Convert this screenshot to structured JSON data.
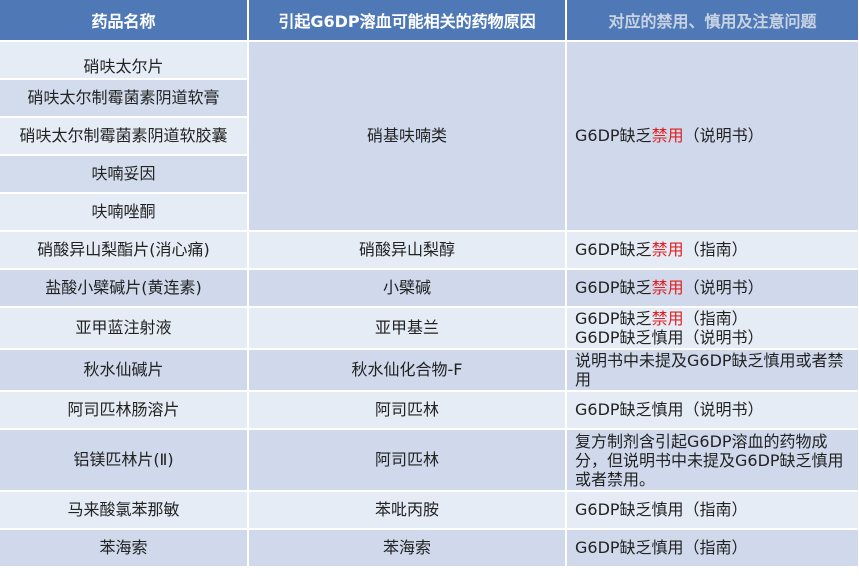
{
  "headers": [
    "药品名称",
    "引起G6DP溶血可能相关的药物原因",
    "对应的禁用、慎用及注意问题"
  ],
  "nitro_group": {
    "drugs": [
      "硝呋太尔片",
      "硝呋太尔制霉菌素阴道软膏",
      "硝呋太尔制霉菌素阴道软胶囊",
      "呋喃妥因",
      "呋喃唑酮"
    ],
    "cause": "硝基呋喃类",
    "note_prefix": "G6DP缺乏",
    "note_red": "禁用",
    "note_suffix": "（说明书）"
  },
  "rows": [
    {
      "name": "硝酸异山梨酯片(消心痛)",
      "cause": "硝酸异山梨醇",
      "note_prefix": "G6DP缺乏",
      "note_red": "禁用",
      "note_suffix": "（指南）"
    },
    {
      "name": "盐酸小檗碱片(黄连素)",
      "cause": "小檗碱",
      "note_prefix": "G6DP缺乏",
      "note_red": "禁用",
      "note_suffix": "（说明书）"
    },
    {
      "name": "亚甲蓝注射液",
      "cause": "亚甲基兰",
      "note_prefix": "G6DP缺乏",
      "note_red": "禁用",
      "note_suffix": "（指南）",
      "note_line2": "G6DP缺乏慎用（说明书）"
    },
    {
      "name": "秋水仙碱片",
      "cause": "秋水仙化合物-F",
      "note": "说明书中未提及G6DP缺乏慎用或者禁用"
    },
    {
      "name": "阿司匹林肠溶片",
      "cause": "阿司匹林",
      "note": "G6DP缺乏慎用（说明书）"
    },
    {
      "name": "铝镁匹林片(Ⅱ)",
      "cause": "阿司匹林",
      "note": "复方制剂含引起G6DP溶血的药物成分，但说明书中未提及G6DP缺乏慎用或者禁用。"
    },
    {
      "name": "马来酸氯苯那敏",
      "cause": "苯吡丙胺",
      "note": "G6DP缺乏慎用（指南）"
    },
    {
      "name": "苯海索",
      "cause": "苯海索",
      "note": "G6DP缺乏慎用（指南）"
    }
  ]
}
